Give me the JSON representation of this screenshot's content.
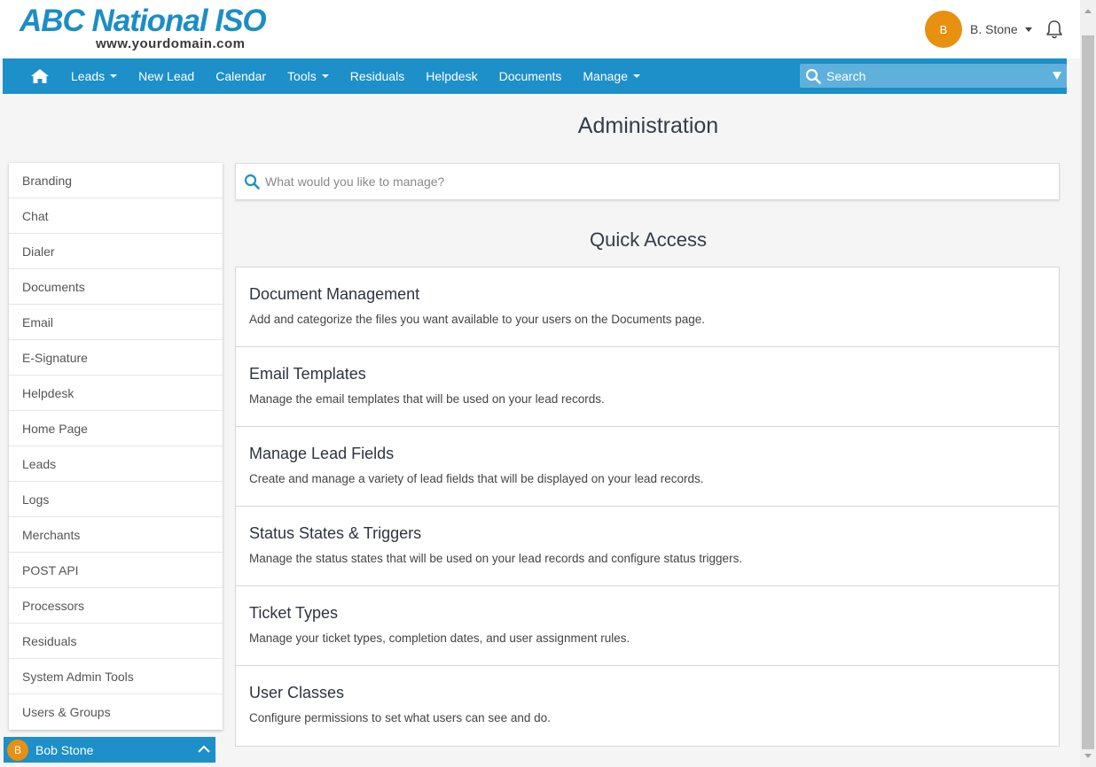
{
  "logo": {
    "title": "ABC National ISO",
    "subtitle": "www.yourdomain.com"
  },
  "user": {
    "initial": "B",
    "name": "B. Stone"
  },
  "nav": {
    "items": [
      {
        "label": "Leads",
        "dropdown": true
      },
      {
        "label": "New Lead",
        "dropdown": false
      },
      {
        "label": "Calendar",
        "dropdown": false
      },
      {
        "label": "Tools",
        "dropdown": true
      },
      {
        "label": "Residuals",
        "dropdown": false
      },
      {
        "label": "Helpdesk",
        "dropdown": false
      },
      {
        "label": "Documents",
        "dropdown": false
      },
      {
        "label": "Manage",
        "dropdown": true
      }
    ],
    "search_label": "Search"
  },
  "page": {
    "title": "Administration",
    "search_placeholder": "What would you like to manage?",
    "quick_access_title": "Quick Access"
  },
  "sidebar": {
    "items": [
      "Branding",
      "Chat",
      "Dialer",
      "Documents",
      "Email",
      "E-Signature",
      "Helpdesk",
      "Home Page",
      "Leads",
      "Logs",
      "Merchants",
      "POST API",
      "Processors",
      "Residuals",
      "System Admin Tools",
      "Users & Groups"
    ]
  },
  "quick_access": [
    {
      "title": "Document Management",
      "desc": "Add and categorize the files you want available to your users on the Documents page."
    },
    {
      "title": "Email Templates",
      "desc": "Manage the email templates that will be used on your lead records."
    },
    {
      "title": "Manage Lead Fields",
      "desc": "Create and manage a variety of lead fields that will be displayed on your lead records."
    },
    {
      "title": "Status States & Triggers",
      "desc": "Manage the status states that will be used on your lead records and configure status triggers."
    },
    {
      "title": "Ticket Types",
      "desc": "Manage your ticket types, completion dates, and user assignment rules."
    },
    {
      "title": "User Classes",
      "desc": "Configure permissions to set what users can see and do."
    }
  ],
  "chat": {
    "initial": "B",
    "name": "Bob Stone"
  },
  "colors": {
    "primary": "#1d8fc9",
    "accent": "#e8900f"
  }
}
